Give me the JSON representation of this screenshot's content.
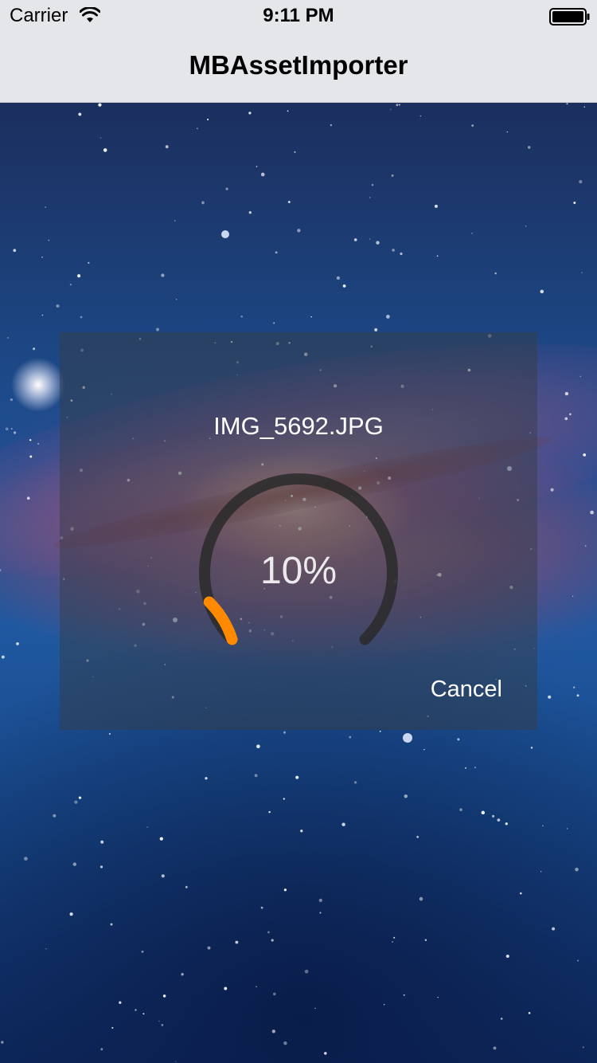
{
  "status_bar": {
    "carrier": "Carrier",
    "time": "9:11 PM",
    "wifi_icon": "wifi-icon",
    "battery_icon": "battery-icon"
  },
  "nav": {
    "title": "MBAssetImporter"
  },
  "hud": {
    "file_name": "IMG_5692.JPG",
    "progress": 0.1,
    "progress_label": "10%",
    "cancel_label": "Cancel",
    "ring_track_color": "#2a2a2a",
    "ring_fill_color": "#ff8a00"
  }
}
